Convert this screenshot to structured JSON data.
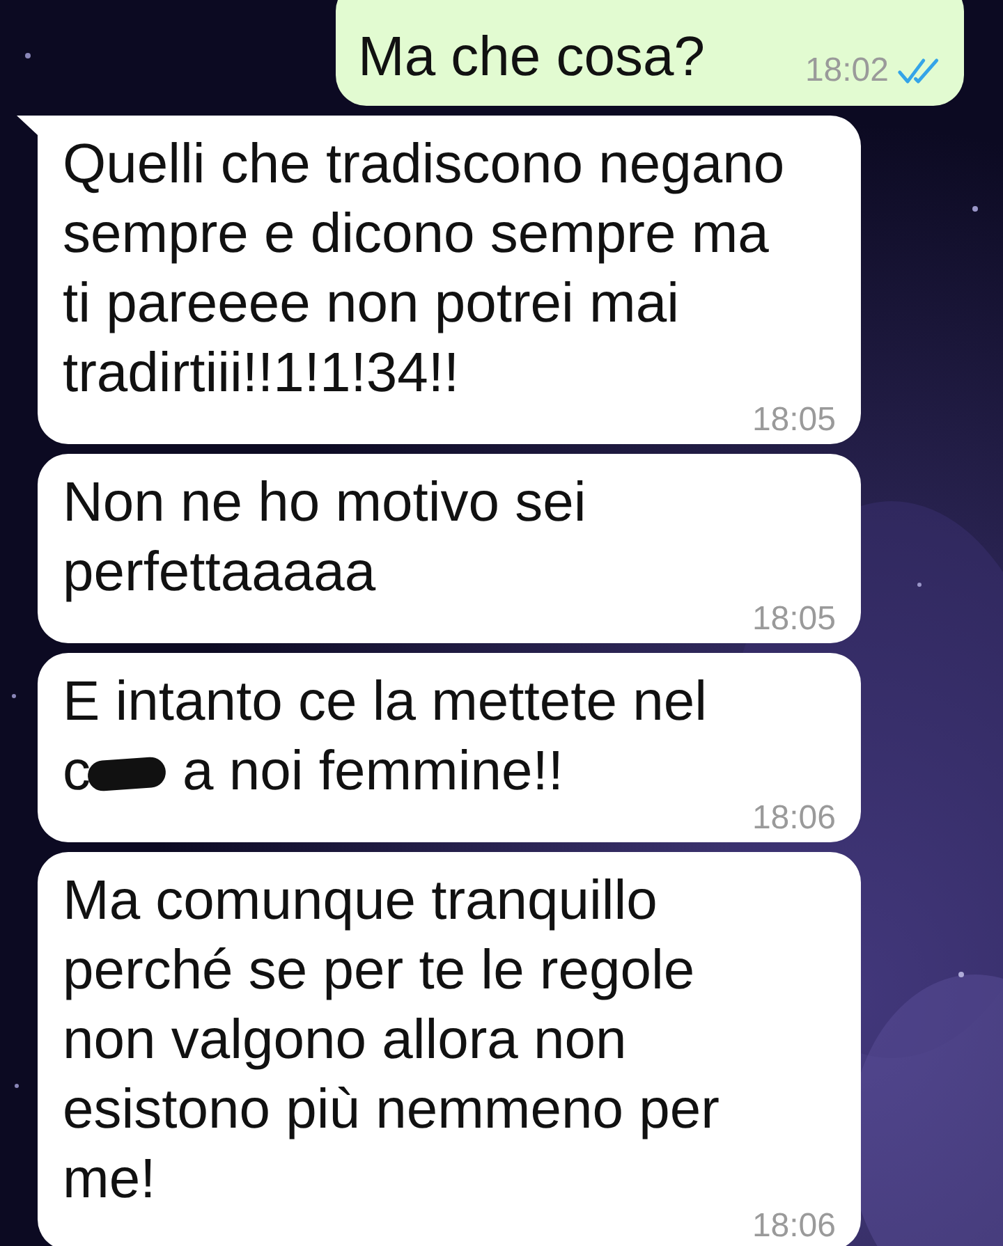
{
  "chat": {
    "messages": [
      {
        "kind": "outgoing",
        "tail": false,
        "text": "Ma che cosa?",
        "redacted": false,
        "time": "18:02",
        "read": true
      },
      {
        "kind": "incoming",
        "tail": true,
        "text": "Quelli che tradiscono negano\nsempre e dicono sempre ma\nti pareeee non potrei mai\ntradirtiii!!1!1!34!!",
        "redacted": false,
        "time": "18:05"
      },
      {
        "kind": "incoming",
        "tail": false,
        "text": "Non ne ho motivo sei\nperfettaaaaa",
        "redacted": false,
        "time": "18:05"
      },
      {
        "kind": "incoming",
        "tail": false,
        "text": "E intanto ce la mettete nel",
        "redacted": true,
        "redacted_prefix": "c",
        "text_after": "a noi femmine!!",
        "time": "18:06"
      },
      {
        "kind": "incoming",
        "tail": false,
        "text": "Ma comunque tranquillo\nperché se per te le regole\nnon valgono allora non\nesistono più nemmeno per\nme!",
        "redacted": false,
        "time": "18:06"
      }
    ]
  }
}
